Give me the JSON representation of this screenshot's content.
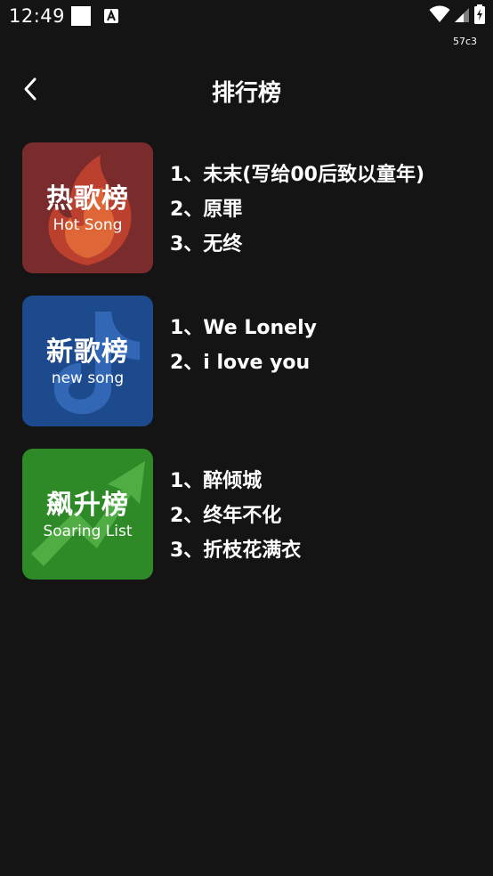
{
  "status_bar": {
    "time": "12:49",
    "build_tag": "57c3"
  },
  "header": {
    "title": "排行榜"
  },
  "charts": [
    {
      "cover_title": "热歌榜",
      "cover_subtitle": "Hot Song",
      "cover_color": "#7a2b2b",
      "tracks": [
        "1、未末(写给00后致以童年)",
        "2、原罪",
        "3、无终"
      ]
    },
    {
      "cover_title": "新歌榜",
      "cover_subtitle": "new song",
      "cover_color": "#1d4a8c",
      "tracks": [
        "1、We Lonely",
        "2、i love you"
      ]
    },
    {
      "cover_title": "飙升榜",
      "cover_subtitle": "Soaring List",
      "cover_color": "#2e8a27",
      "tracks": [
        "1、醉倾城",
        "2、终年不化",
        "3、折枝花满衣"
      ]
    }
  ]
}
